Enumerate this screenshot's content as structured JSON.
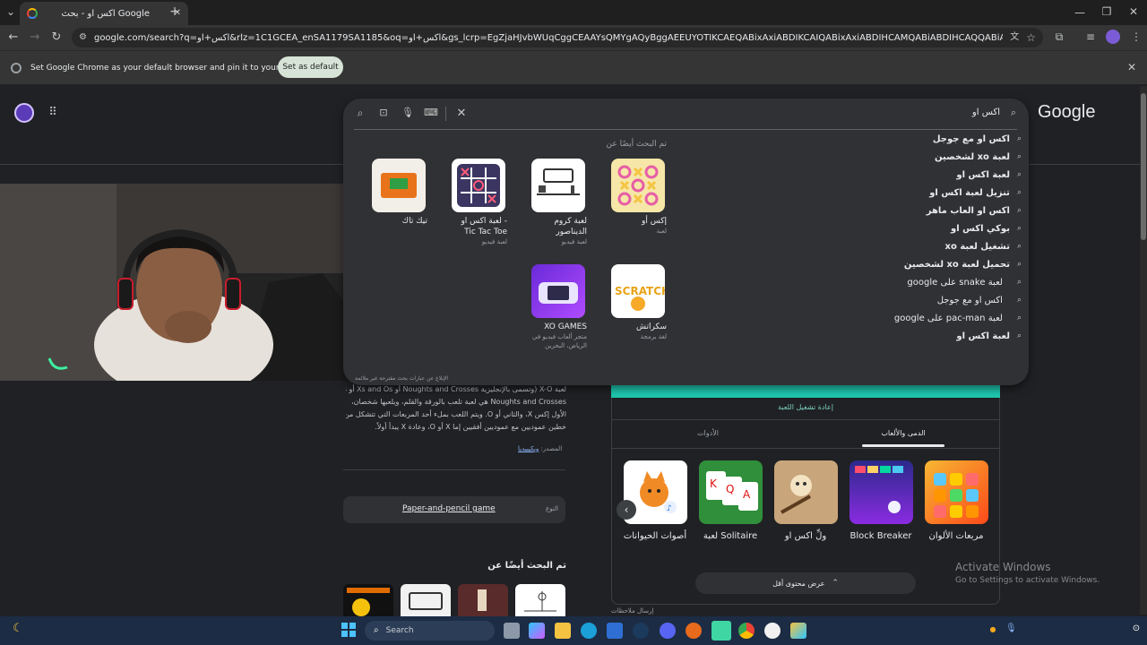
{
  "browser": {
    "tab_title": "اكس او - بحث Google",
    "url": "google.com/search?q=اكس+او&rlz=1C1GCEA_enSA1179SA1185&oq=اكس+او&gs_lcrp=EgZjaHJvbWUqCggCEAAYsQMYgAQyBggAEEUYOTIKCAEQABixAxiABDIKCAIQABixAxiABDIHCAMQABiABDIHCAQQABiABDIHCAUQABiABDIHCAYQABiABDIHC...",
    "infobar_text": "Set Google Chrome as your default browser and pin it to your taskbar",
    "set_default_label": "Set as default"
  },
  "search": {
    "logo": "Google",
    "query": "اكس او",
    "suggestions": [
      {
        "bold": "اكس او مع جوجل",
        "rest": ""
      },
      {
        "bold": "لعبة xo لشخصين",
        "rest": ""
      },
      {
        "bold": "لعبة اكس او",
        "rest": ""
      },
      {
        "bold": "تنزيل لعبة اكس او",
        "rest": ""
      },
      {
        "bold": "اكس او العاب ماهر",
        "rest": ""
      },
      {
        "bold": "بوكي اكس او",
        "rest": ""
      },
      {
        "bold": "تشغيل لعبة xo",
        "rest": ""
      },
      {
        "bold": "تحميل لعبة xo لشخصين",
        "rest": ""
      },
      {
        "bold": "",
        "rest": "لعبة snake على google"
      },
      {
        "bold": "",
        "rest": "اكس او مع جوجل"
      },
      {
        "bold": "",
        "rest": "لعبة pac-man على google"
      },
      {
        "bold": "لعبة اكس او",
        "rest": ""
      }
    ],
    "people_also_search": "تم البحث أيضًا عن",
    "cards": [
      {
        "name": "إكس أو",
        "sub": "لعبة"
      },
      {
        "name": "لعبة كروم الديناصور",
        "sub": "لعبة فيديو"
      },
      {
        "name": "لعبة اكس او - Tic Tac Toe",
        "sub": "لعبة فيديو"
      },
      {
        "name": "تيك تاك",
        "sub": ""
      },
      {
        "name": "سكراتش",
        "sub": "لغة برمجة"
      },
      {
        "name": "XO GAMES",
        "sub": "متجر ألعاب فيديو في الرياض، البحرين"
      }
    ],
    "report": "الإبلاغ عن عبارات بحث مقترحة غير ملائمة"
  },
  "knowledge": {
    "text_lines": [
      "لعبة X-O (وتسمى بالإنجليزية Noughts and Crosses أو Xs and Os أو Tic Tac Toe Xs and Os",
      "Noughts and Crosses هي لعبة تلعب بالورقة والقلم، ويلعبها شخصان،",
      "الأول إكس X، والثاني أو O. ويتم اللعب بملء أحد المربعات التي تتشكل من تقاطع",
      "خطين عموديين مع عموديين أفقيين إما X أو O، وعادة X يبدأ أولاً."
    ],
    "source_label": "المصدر:",
    "source_link": "ويكيبيديا",
    "type_label": "النوع",
    "type_value": "Paper-and-pencil game",
    "also_search": "تم البحث أيضًا عن"
  },
  "games_panel": {
    "replay": "إعادة تشغيل اللعبة",
    "tab_games": "الدمى والألعاب",
    "tab_tools": "الأدوات",
    "tiles": [
      {
        "label": "مربعات الألوان"
      },
      {
        "label": "Block Breaker"
      },
      {
        "label": "ولِّ اكس او"
      },
      {
        "label": "لعبة Solitaire"
      },
      {
        "label": "أصوات الحيوانات"
      }
    ],
    "show_less": "عرض محتوى أقل",
    "feedback": "إرسال ملاحظات"
  },
  "watermark": {
    "title": "Activate Windows",
    "sub": "Go to Settings to activate Windows."
  },
  "taskbar": {
    "search_placeholder": "Search"
  }
}
